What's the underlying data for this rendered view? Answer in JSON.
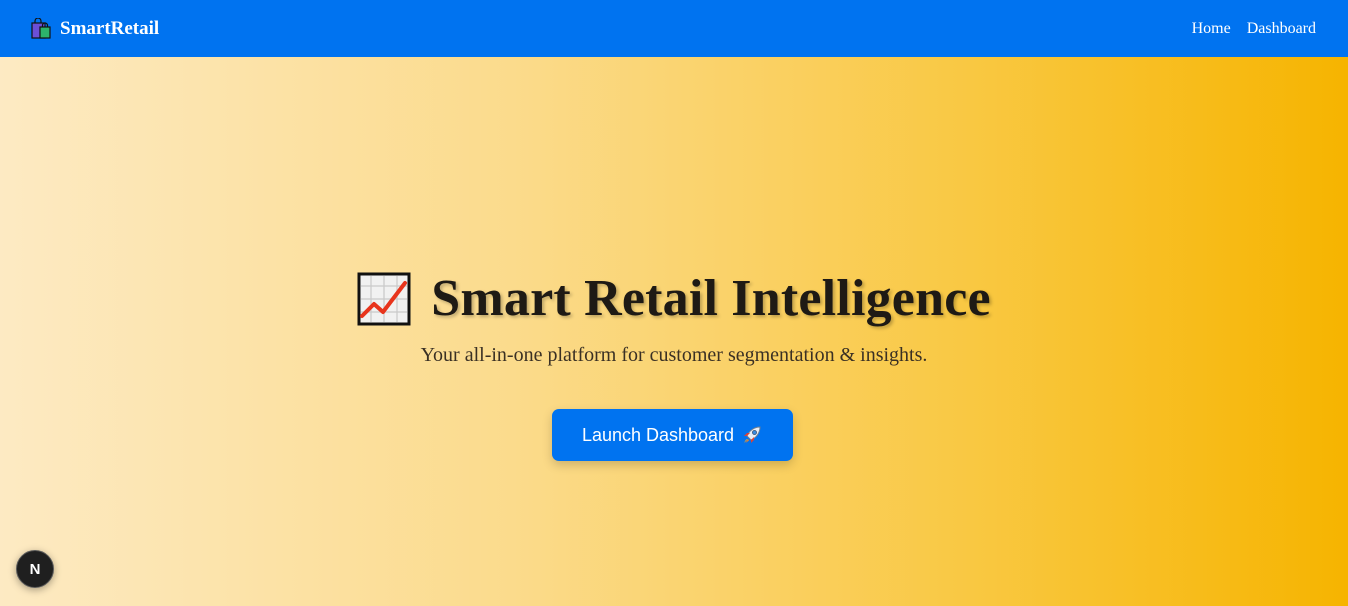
{
  "header": {
    "brand_icon": "shopping-bags-icon",
    "brand_name": "SmartRetail",
    "nav": [
      {
        "label": "Home"
      },
      {
        "label": "Dashboard"
      }
    ],
    "background_color": "#0073f0"
  },
  "hero": {
    "title_icon": "chart-increasing-icon",
    "title": "Smart Retail Intelligence",
    "subtitle": "Your all-in-one platform for customer segmentation & insights.",
    "cta_label": "Launch Dashboard",
    "cta_icon": "rocket-icon",
    "gradient_colors": [
      "#fdeac3",
      "#f6b400"
    ]
  },
  "dev_badge": {
    "label": "N"
  }
}
